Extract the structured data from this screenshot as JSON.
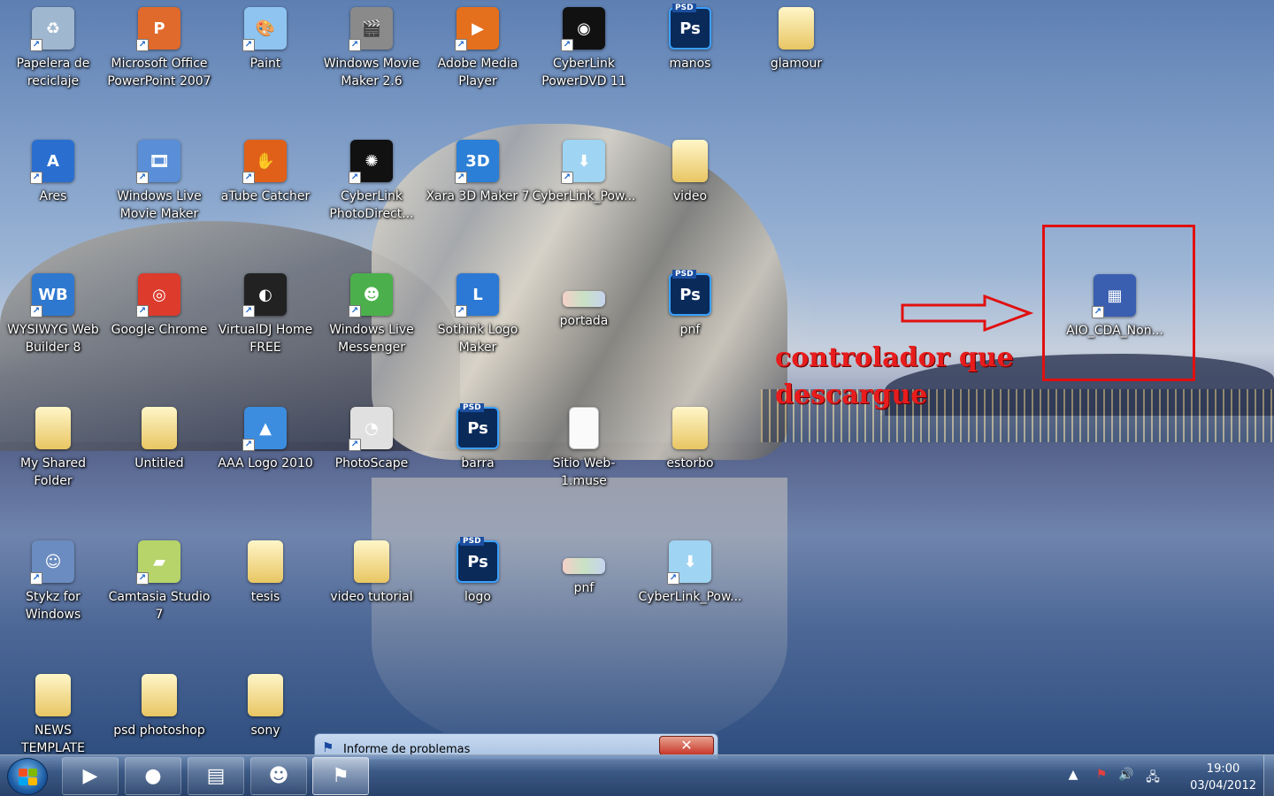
{
  "desktop": {
    "icons": [
      {
        "label": "Papelera de reciclaje",
        "icon": "recycle-bin-icon",
        "color": "#9fb7cf"
      },
      {
        "label": "Microsoft Office PowerPoint 2007",
        "icon": "powerpoint-icon",
        "color": "#e06a2c"
      },
      {
        "label": "Paint",
        "icon": "paint-icon",
        "color": "#8fc4f0"
      },
      {
        "label": "Windows Movie Maker 2.6",
        "icon": "movie-maker-icon",
        "color": "#8a8a8a"
      },
      {
        "label": "Adobe Media Player",
        "icon": "media-player-icon",
        "color": "#e4701e"
      },
      {
        "label": "CyberLink PowerDVD 11",
        "icon": "powerdvd-icon",
        "color": "#111111"
      },
      {
        "label": "manos",
        "icon": "photoshop-file-icon"
      },
      {
        "label": "glamour",
        "icon": "folder-icon"
      },
      {
        "label": "Ares",
        "icon": "ares-icon",
        "color": "#2a6fd0"
      },
      {
        "label": "Windows Live Movie Maker",
        "icon": "live-movie-maker-icon",
        "color": "#5a8fd8"
      },
      {
        "label": "aTube Catcher",
        "icon": "atube-catcher-icon",
        "color": "#e0601a"
      },
      {
        "label": "CyberLink PhotoDirect...",
        "icon": "photodirector-icon",
        "color": "#111111"
      },
      {
        "label": "Xara 3D Maker 7",
        "icon": "xara-3d-icon",
        "color": "#2b7fd6"
      },
      {
        "label": "CyberLink_Pow...",
        "icon": "cyberlink-setup-icon",
        "color": "#9fd4f2"
      },
      {
        "label": "video",
        "icon": "folder-chrome-icon"
      },
      {
        "label": "WYSIWYG Web Builder 8",
        "icon": "web-builder-icon",
        "color": "#2f78d0"
      },
      {
        "label": "Google Chrome",
        "icon": "chrome-icon",
        "color": "#dd3b2c"
      },
      {
        "label": "VirtualDJ Home FREE",
        "icon": "virtualdj-icon",
        "color": "#222222"
      },
      {
        "label": "Windows Live Messenger",
        "icon": "messenger-icon",
        "color": "#4bb04b"
      },
      {
        "label": "Sothink Logo Maker",
        "icon": "logo-maker-icon",
        "color": "#2c79d5"
      },
      {
        "label": "portada",
        "icon": "image-file-icon"
      },
      {
        "label": "pnf",
        "icon": "photoshop-file-icon"
      },
      {
        "label": "My Shared Folder",
        "icon": "folder-icon"
      },
      {
        "label": "Untitled",
        "icon": "folder-icon"
      },
      {
        "label": "AAA Logo 2010",
        "icon": "aaa-logo-icon",
        "color": "#3c8de0"
      },
      {
        "label": "PhotoScape",
        "icon": "photoscape-icon",
        "color": "#e0e0e0"
      },
      {
        "label": "barra",
        "icon": "photoshop-file-icon"
      },
      {
        "label": "Sitio Web-1.muse",
        "icon": "blank-document-icon"
      },
      {
        "label": "estorbo",
        "icon": "folder-icon"
      },
      {
        "label": "Stykz for Windows",
        "icon": "stykz-icon"
      },
      {
        "label": "Camtasia Studio 7",
        "icon": "camtasia-icon",
        "color": "#b6d46a"
      },
      {
        "label": "tesis",
        "icon": "folder-icon"
      },
      {
        "label": "video tutorial",
        "icon": "folder-icon"
      },
      {
        "label": "logo",
        "icon": "photoshop-file-icon"
      },
      {
        "label": "pnf",
        "icon": "image-file-icon"
      },
      {
        "label": "CyberLink_Pow...",
        "icon": "cyberlink-setup-icon",
        "color": "#9fd4f2"
      },
      {
        "label": "NEWS TEMPLATE",
        "icon": "folder-icon"
      },
      {
        "label": "psd photoshop",
        "icon": "folder-icon"
      },
      {
        "label": "sony",
        "icon": "folder-icon"
      },
      {
        "label": "AIO_CDA_Non...",
        "icon": "installer-icon",
        "color": "#3a5fb0"
      }
    ],
    "annotation": {
      "text": "controlador que descargue",
      "color": "#e81c1c"
    }
  },
  "dialog": {
    "title": "Informe de problemas",
    "close": "✕"
  },
  "taskbar": {
    "buttons": [
      {
        "name": "media-player-taskbar",
        "glyph": "▶"
      },
      {
        "name": "chrome-taskbar",
        "glyph": "●"
      },
      {
        "name": "explorer-taskbar",
        "glyph": "▤"
      },
      {
        "name": "messenger-taskbar",
        "glyph": "☻"
      },
      {
        "name": "problem-report-taskbar",
        "glyph": "⚑"
      }
    ],
    "time": "19:00",
    "date": "03/04/2012",
    "tray": [
      "▲",
      "⚑",
      "🔊",
      "🖧"
    ]
  },
  "colors": {
    "accent_red": "#e01010",
    "folder": "#e8c663",
    "photoshop": "#0a2a5a"
  }
}
